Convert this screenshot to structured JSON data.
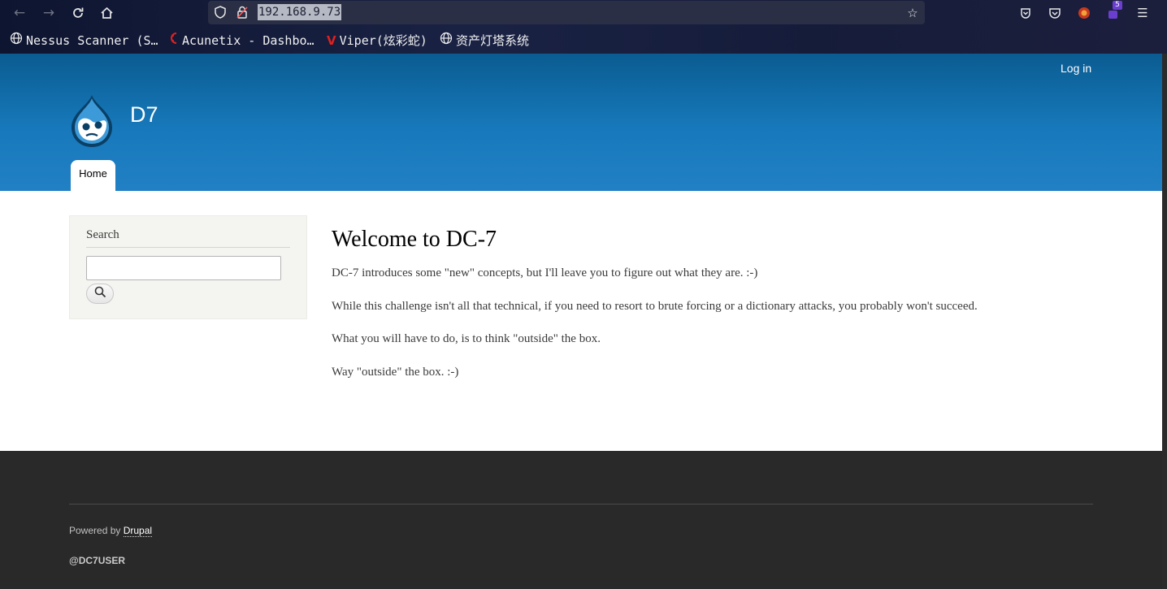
{
  "browser": {
    "url": "192.168.9.73",
    "bookmarks": [
      {
        "label": "Nessus Scanner (S…",
        "icon": "globe-icon"
      },
      {
        "label": "Acunetix - Dashbo…",
        "icon": "acunetix-icon"
      },
      {
        "label": "Viper(炫彩蛇)",
        "icon": "viper-icon"
      },
      {
        "label": "资产灯塔系统",
        "icon": "globe-icon"
      }
    ],
    "extension_badge": "5"
  },
  "site": {
    "name": "D7",
    "login_label": "Log in",
    "nav": [
      {
        "label": "Home"
      }
    ]
  },
  "sidebar": {
    "search_title": "Search",
    "search_placeholder": ""
  },
  "main": {
    "title": "Welcome to DC-7",
    "paragraphs": [
      "DC-7 introduces some \"new\" concepts, but I'll leave you to figure out what they are.  :-)",
      "While this challenge isn't all that technical, if you need to resort to brute forcing or a dictionary attacks, you probably won't succeed.",
      "What you will have to do, is to think \"outside\" the box.",
      "Way \"outside\" the box.  :-)"
    ]
  },
  "footer": {
    "powered_prefix": "Powered by ",
    "powered_link": "Drupal",
    "user": "@DC7USER"
  },
  "colors": {
    "header_top": "#0a5c91",
    "header_bottom": "#2180c4",
    "footer_bg": "#292929",
    "sidebar_bg": "#f4f4f1"
  }
}
